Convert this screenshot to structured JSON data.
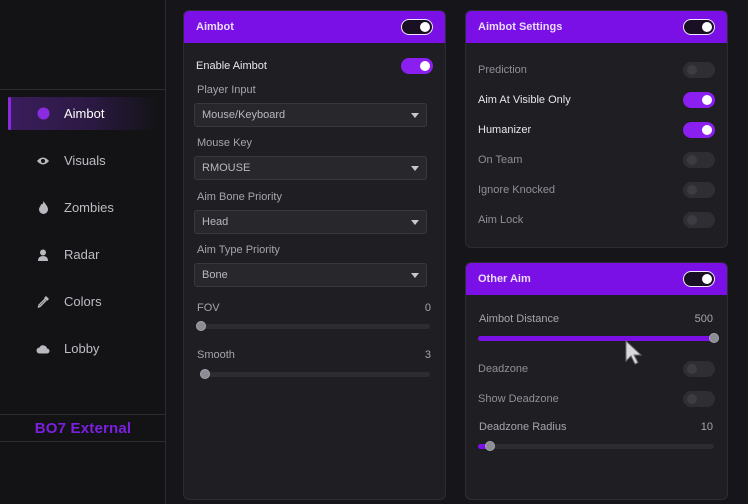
{
  "sidebar": {
    "items": [
      {
        "label": "Aimbot",
        "icon": "circle-icon"
      },
      {
        "label": "Visuals",
        "icon": "eye-icon"
      },
      {
        "label": "Zombies",
        "icon": "flame-icon"
      },
      {
        "label": "Radar",
        "icon": "user-icon"
      },
      {
        "label": "Colors",
        "icon": "eyedropper-icon"
      },
      {
        "label": "Lobby",
        "icon": "cloud-icon"
      }
    ],
    "active": "Aimbot",
    "brand": "BO7 External"
  },
  "aimbot": {
    "title": "Aimbot",
    "enabled": true,
    "enable_label": "Enable Aimbot",
    "enable_value": true,
    "player_input_label": "Player Input",
    "player_input_value": "Mouse/Keyboard",
    "mouse_key_label": "Mouse Key",
    "mouse_key_value": "RMOUSE",
    "bone_label": "Aim Bone Priority",
    "bone_value": "Head",
    "type_label": "Aim Type Priority",
    "type_value": "Bone",
    "fov_label": "FOV",
    "fov_value": "0",
    "fov_fraction": 0,
    "smooth_label": "Smooth",
    "smooth_value": "3",
    "smooth_fraction": 0.0
  },
  "settings": {
    "title": "Aimbot Settings",
    "enabled": true,
    "items": [
      {
        "label": "Prediction",
        "on": false
      },
      {
        "label": "Aim At Visible Only",
        "on": true
      },
      {
        "label": "Humanizer",
        "on": true
      },
      {
        "label": "On Team",
        "on": false
      },
      {
        "label": "Ignore Knocked",
        "on": false
      },
      {
        "label": "Aim Lock",
        "on": false
      }
    ]
  },
  "other": {
    "title": "Other Aim",
    "enabled": true,
    "distance_label": "Aimbot Distance",
    "distance_value": "500",
    "distance_fraction": 1.0,
    "deadzone_label": "Deadzone",
    "deadzone_on": false,
    "show_deadzone_label": "Show Deadzone",
    "show_deadzone_on": false,
    "radius_label": "Deadzone Radius",
    "radius_value": "10",
    "radius_fraction": 0.05
  },
  "colors": {
    "accent": "#7b10e6",
    "background": "#16161a",
    "panel": "#1f1f23"
  }
}
